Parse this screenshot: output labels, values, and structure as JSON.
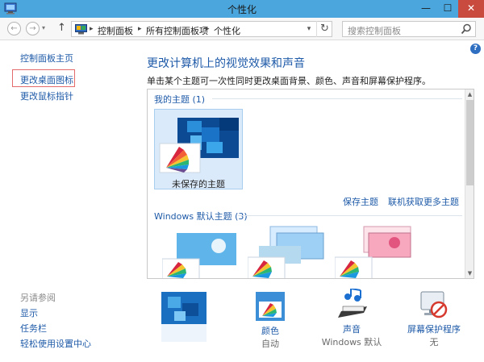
{
  "window": {
    "title": "个性化"
  },
  "window_controls": {
    "minimize": "—",
    "maximize": "☐",
    "close": "✕"
  },
  "address_bar": {
    "crumbs": [
      "控制面板",
      "所有控制面板项",
      "个性化"
    ],
    "search_placeholder": "搜索控制面板"
  },
  "sidebar": {
    "home": "控制面板主页",
    "links": [
      "更改桌面图标",
      "更改鼠标指针"
    ],
    "see_also_title": "另请参阅",
    "see_also": [
      "显示",
      "任务栏",
      "轻松使用设置中心"
    ]
  },
  "main": {
    "title": "更改计算机上的视觉效果和声音",
    "description": "单击某个主题可一次性同时更改桌面背景、颜色、声音和屏幕保护程序。"
  },
  "themes": {
    "my_themes_title": "我的主题 (1)",
    "unsaved_theme_label": "未保存的主题",
    "save_theme": "保存主题",
    "get_more_online": "联机获取更多主题",
    "windows_default_title": "Windows 默认主题 (3)"
  },
  "bottom_bar": {
    "color": {
      "label": "颜色",
      "value": "自动"
    },
    "sound": {
      "label": "声音",
      "value": "Windows 默认"
    },
    "screensaver": {
      "label": "屏幕保护程序",
      "value": "无"
    }
  },
  "colors": {
    "titlebar": "#4aa6dc",
    "close_button": "#c94a3e",
    "link": "#1e5aa8",
    "highlight_border": "#e46b6b"
  }
}
